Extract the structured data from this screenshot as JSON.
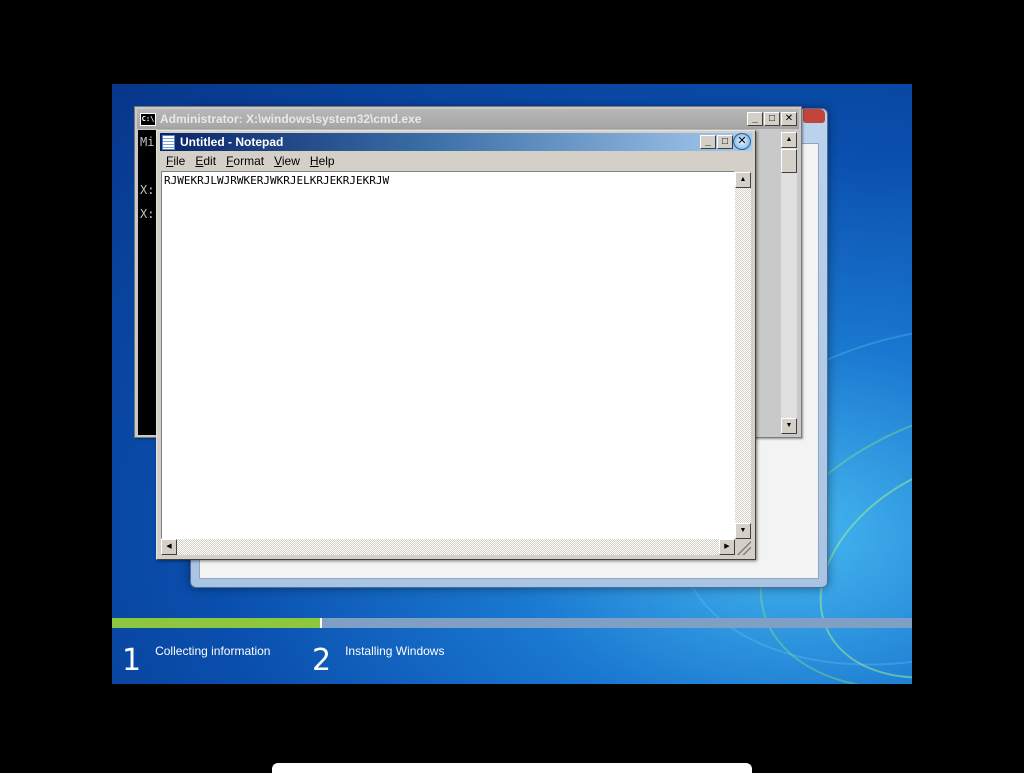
{
  "setup": {
    "steps": [
      {
        "number": "1",
        "label": "Collecting information"
      },
      {
        "number": "2",
        "label": "Installing Windows"
      }
    ],
    "progress": 0.26
  },
  "cmd": {
    "title": "Administrator: X:\\windows\\system32\\cmd.exe",
    "icon_text": "C:\\",
    "lines": [
      "Mi",
      "",
      "X:",
      "X:"
    ],
    "buttons": {
      "minimize": "_",
      "maximize": "□",
      "close": "✕"
    }
  },
  "notepad": {
    "title": "Untitled - Notepad",
    "menu": [
      {
        "key": "F",
        "rest": "ile"
      },
      {
        "key": "E",
        "rest": "dit"
      },
      {
        "key": "F",
        "rest": "ormat",
        "prefix": ""
      },
      {
        "key": "V",
        "rest": "iew"
      },
      {
        "key": "H",
        "rest": "elp"
      }
    ],
    "content": "RJWEKRJLWJRWKERJWKRJELKRJEKRJEKRJW",
    "buttons": {
      "minimize": "_",
      "maximize": "□",
      "close": "✕"
    }
  },
  "icons": {
    "cmd_app": "console-icon",
    "notepad_app": "notepad-icon",
    "scroll_up": "▲",
    "scroll_down": "▼",
    "scroll_left": "◀",
    "scroll_right": "▶"
  }
}
